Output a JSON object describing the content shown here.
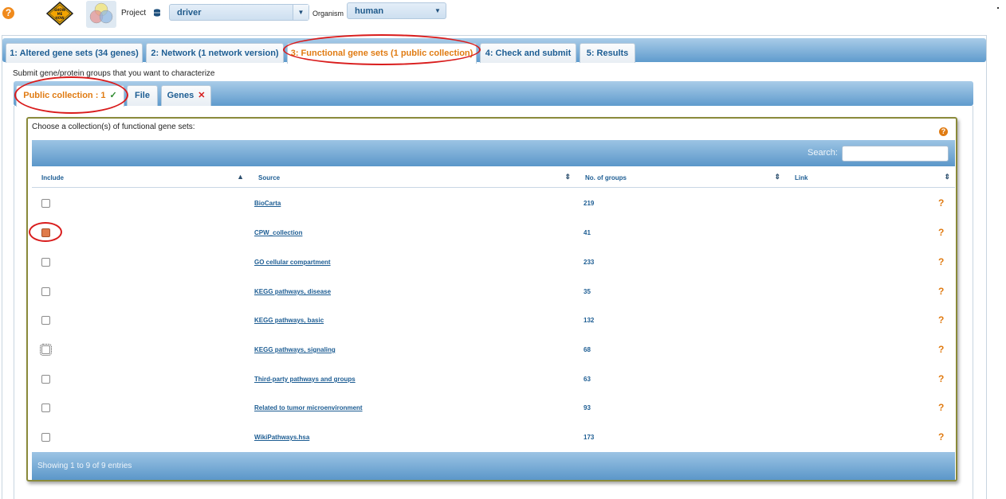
{
  "header": {
    "help_glyph": "?",
    "showme_label": "SHOW ME HOW",
    "project_label": "Project",
    "project_value": "driver",
    "organism_label": "Organism",
    "organism_value": "human"
  },
  "main_tabs": [
    {
      "label": "1: Altered gene sets (34 genes)"
    },
    {
      "label": "2: Network (1 network version)"
    },
    {
      "label": "3: Functional gene sets (1 public collection)",
      "active": true
    },
    {
      "label": "4: Check and submit"
    },
    {
      "label": "5: Results"
    }
  ],
  "submit_label": "Submit gene/protein groups that you want to characterize",
  "sub_tabs": [
    {
      "label": "Public collection : 1",
      "mark": "✓",
      "active": true
    },
    {
      "label": "File"
    },
    {
      "label": "Genes",
      "mark": "✕"
    }
  ],
  "collection": {
    "prompt": "Choose a collection(s) of functional gene sets:",
    "help_glyph": "?",
    "search_label": "Search:",
    "search_value": "",
    "columns": [
      "Include",
      "Source",
      "No. of groups",
      "Link"
    ],
    "rows": [
      {
        "source": "BioCarta",
        "groups": "219",
        "checked": false,
        "link": "?"
      },
      {
        "source": "CPW_collection",
        "groups": "41",
        "checked": true,
        "link": "?"
      },
      {
        "source": "GO cellular compartment",
        "groups": "233",
        "checked": false,
        "link": "?"
      },
      {
        "source": "KEGG pathways, disease",
        "groups": "35",
        "checked": false,
        "link": "?"
      },
      {
        "source": "KEGG pathways, basic",
        "groups": "132",
        "checked": false,
        "link": "?"
      },
      {
        "source": "KEGG pathways, signaling",
        "groups": "68",
        "checked": false,
        "link": "?"
      },
      {
        "source": "Third-party pathways and groups",
        "groups": "63",
        "checked": false,
        "link": "?"
      },
      {
        "source": "Related to tumor microenvironment",
        "groups": "93",
        "checked": false,
        "link": "?"
      },
      {
        "source": "WikiPathways.hsa",
        "groups": "173",
        "checked": false,
        "link": "?"
      }
    ],
    "footer": "Showing 1 to 9 of 9 entries"
  },
  "colors": {
    "accent_orange": "#e07b12",
    "link_blue": "#1d5d93",
    "highlight_red": "#d91c1c"
  }
}
